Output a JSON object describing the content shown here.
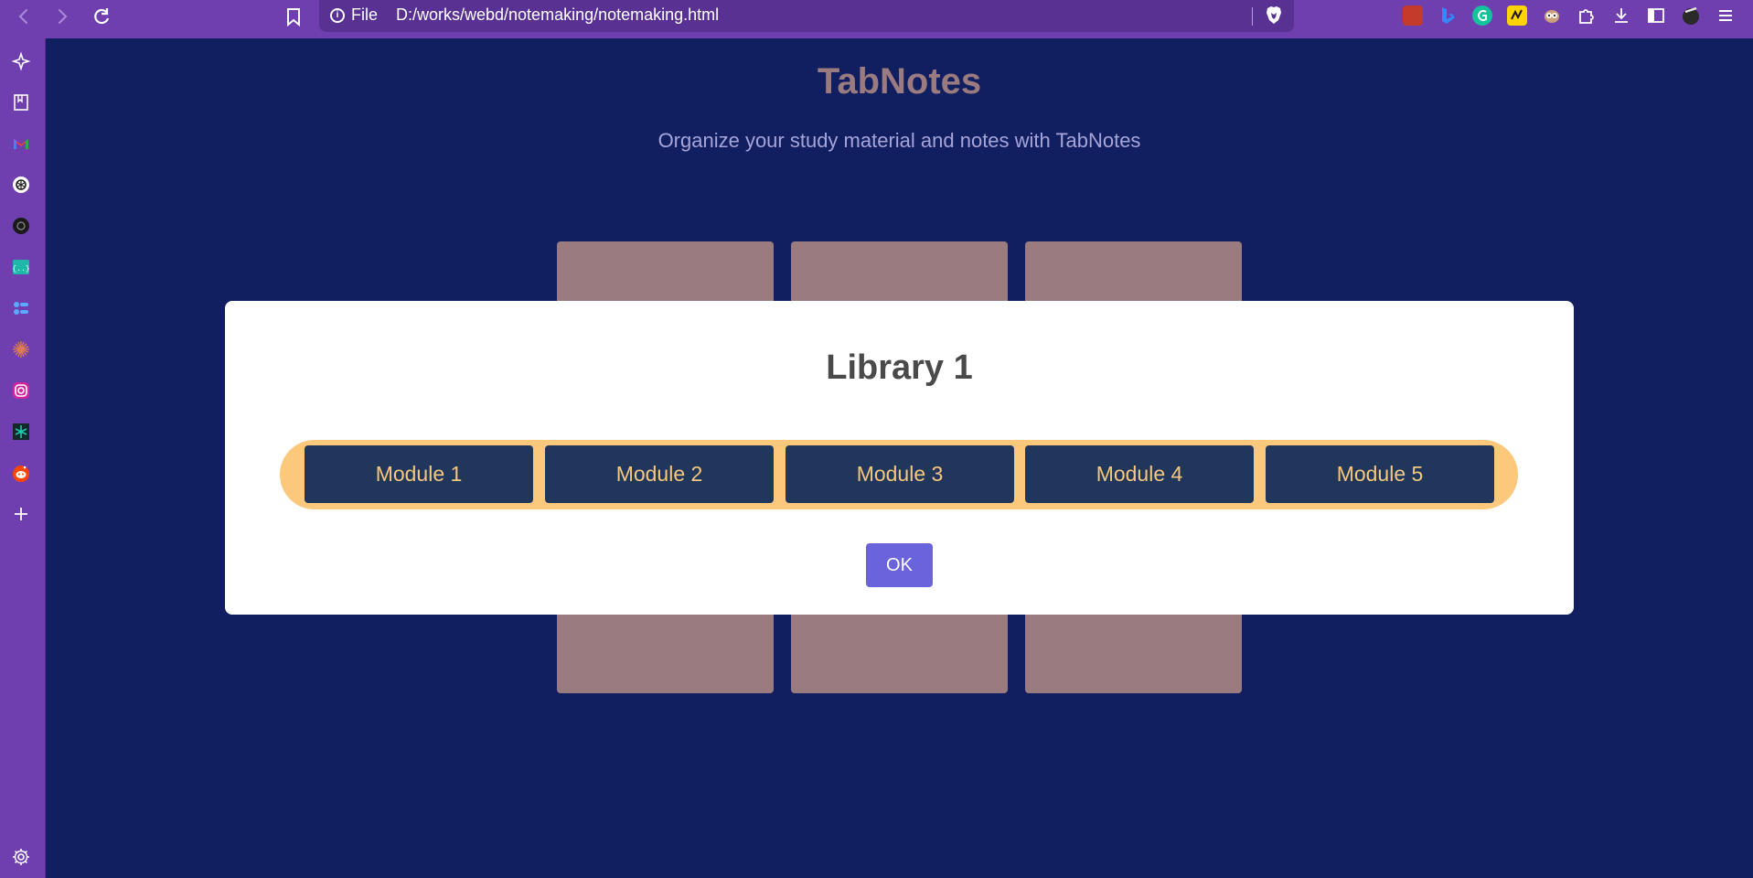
{
  "browser": {
    "file_label": "File",
    "url": "D:/works/webd/notemaking/notemaking.html"
  },
  "page": {
    "title": "TabNotes",
    "subtitle": "Organize your study material and notes with TabNotes"
  },
  "modal": {
    "title": "Library 1",
    "modules": [
      "Module 1",
      "Module 2",
      "Module 3",
      "Module 4",
      "Module 5"
    ],
    "ok_label": "OK"
  },
  "colors": {
    "chrome": "#6f3fb0",
    "background": "#111e60",
    "tile": "#9a7b80",
    "module_bar": "#fbc87c",
    "module_button": "#20365a",
    "module_text": "#f6c77f",
    "ok_button": "#6b63dc"
  },
  "icons": {
    "toolbar": [
      "back-icon",
      "forward-icon",
      "reload-icon",
      "bookmark-icon",
      "info-icon",
      "brave-shield-icon"
    ],
    "extensions": [
      "pdf-extension-icon",
      "bing-extension-icon",
      "grammarly-icon",
      "norton-extension-icon",
      "owl-extension-icon",
      "extensions-puzzle-icon",
      "downloads-icon",
      "sidebar-toggle-icon",
      "profile-avatar-icon",
      "menu-icon"
    ],
    "sidebar": [
      "leo-ai-icon",
      "bookmarks-icon",
      "gmail-icon",
      "chatgpt-icon",
      "perplexity-icon",
      "code-icon",
      "toggle-app-icon",
      "claude-icon",
      "instagram-icon",
      "perplexity-alt-icon",
      "reddit-icon",
      "add-icon",
      "settings-icon"
    ]
  }
}
